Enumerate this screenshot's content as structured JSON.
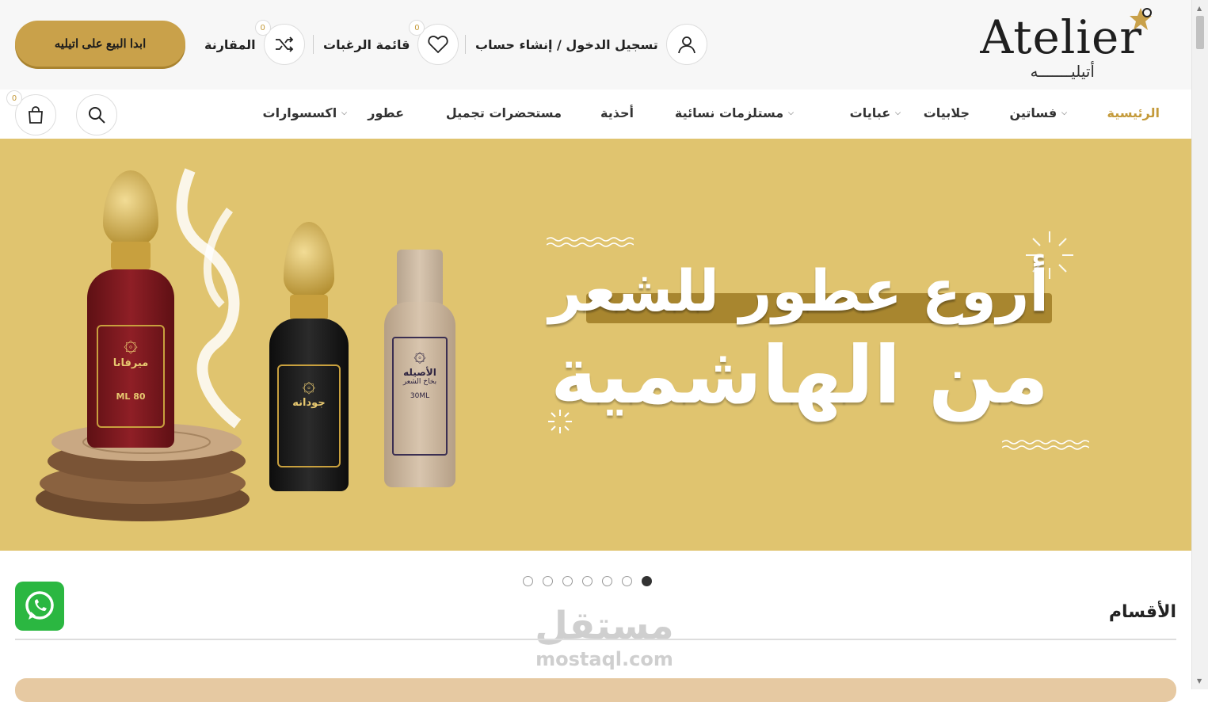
{
  "header": {
    "logo_latin": "Atelier",
    "logo_arabic": "أتيليـــــــه",
    "account_label": "تسجيل الدخول / إنشاء حساب",
    "wishlist_label": "قائمة الرغبات",
    "wishlist_count": "0",
    "compare_label": "المقارنة",
    "compare_count": "0",
    "sell_button": "ابدا البيع على اتيليه"
  },
  "nav": {
    "items": [
      {
        "label": "الرئيسية",
        "active": true
      },
      {
        "label": "فساتين",
        "dropdown": true
      },
      {
        "label": "جلابيات"
      },
      {
        "label": "عبايات",
        "dropdown": true
      },
      {
        "label": "مستلزمات نسائية",
        "dropdown": true
      },
      {
        "label": "أحذية"
      },
      {
        "label": "مستحضرات تجميل"
      },
      {
        "label": "عطور"
      },
      {
        "label": "اكسسوارات",
        "dropdown": true
      }
    ],
    "cart_count": "0"
  },
  "banner": {
    "headline_line1": "أروع عطور للشعر",
    "headline_line2": "من الهاشمية",
    "bottle1_name": "ميرفانا",
    "bottle1_size": "ML 80",
    "bottle2_name": "جودانه",
    "bottle3_name": "الأصيله",
    "bottle3_sub": "بخاخ الشعر",
    "bottle3_size": "30ML",
    "slides": 7,
    "active_slide": 7
  },
  "section": {
    "title": "الأقسام"
  },
  "watermark": {
    "arabic": "مستقل",
    "latin": "mostaql.com"
  },
  "colors": {
    "accent": "#c49a3a",
    "banner_bg": "#e0c46f",
    "button": "#c9a14a",
    "whatsapp": "#2bb741"
  }
}
